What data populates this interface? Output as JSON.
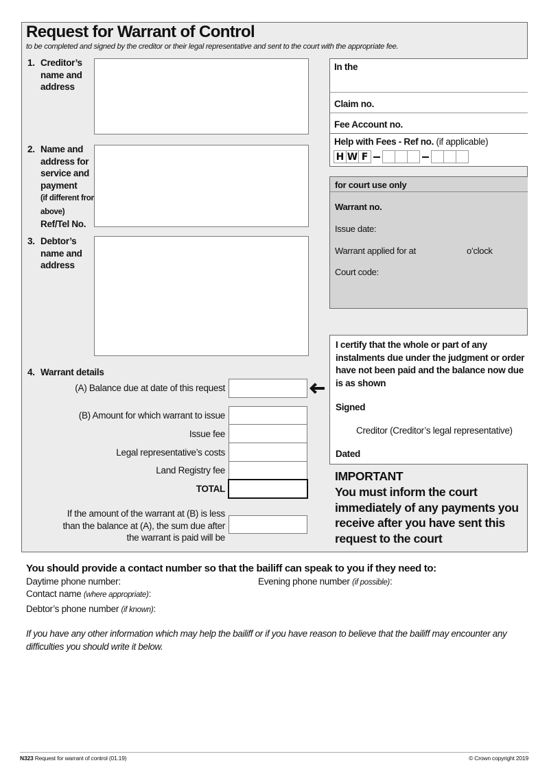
{
  "header": {
    "title": "Request for Warrant of Control",
    "subtitle": "to be completed and signed by the creditor or their legal representative and sent to the court with the appropriate fee."
  },
  "sections": {
    "creditor": {
      "number": "1.",
      "label": "Creditor’s name and address",
      "value": ""
    },
    "service": {
      "number": "2.",
      "label": "Name and address for service and payment",
      "note": "(if different from above)",
      "ref": "Ref/Tel No.",
      "value": ""
    },
    "debtor": {
      "number": "3.",
      "label": "Debtor’s name and address",
      "value": ""
    },
    "warrant": {
      "number": "4.",
      "label": "Warrant details",
      "balance_due_label": "(A) Balance due at date of this request",
      "balance_due_value": "",
      "amount_label": "(B) Amount for which warrant to issue",
      "amount_value": "",
      "issue_fee_label": "Issue fee",
      "issue_fee_value": "",
      "legal_costs_label": "Legal representative’s costs",
      "legal_costs_value": "",
      "land_registry_label": "Land Registry fee",
      "land_registry_value": "",
      "total_label": "TOTAL",
      "total_value": "",
      "remaining_label": "If the amount of the warrant at (B) is less than the balance at (A), the sum due after the warrant is paid will be",
      "remaining_value": "",
      "arrow_icon": "arrow-left-icon"
    }
  },
  "right": {
    "in_the_label": "In the",
    "in_the_value": "",
    "claim_no_label": "Claim no.",
    "claim_no_value": "",
    "fee_account_label": "Fee Account no.",
    "fee_account_value": "",
    "hwf_label": "Help with Fees - Ref no.",
    "hwf_note": "(if applicable)",
    "hwf_prefix": [
      "H",
      "W",
      "F"
    ],
    "hwf_group1": [
      "",
      "",
      ""
    ],
    "hwf_group2": [
      "",
      "",
      ""
    ]
  },
  "court_use": {
    "heading": "for court use only",
    "warrant_no": "Warrant no.",
    "issue_date": "Issue date:",
    "applied_for_at": "Warrant applied for at",
    "oclock": "o’clock",
    "court_code": "Court code:"
  },
  "certify": {
    "statement": "I certify that the whole or part of any instalments due under the judgment or order have not been paid and the balance now due is as shown",
    "signed_label": "Signed",
    "signer_role": "Creditor (Creditor’s legal representative)",
    "dated_label": "Dated"
  },
  "important": {
    "heading": "IMPORTANT",
    "text": "You must inform the court immediately of any payments you receive after you have sent this request to the court"
  },
  "contact": {
    "heading": "You should provide a contact number so that the bailiff can speak to you if they need to:",
    "daytime_label": "Daytime phone number:",
    "evening_label": "Evening phone number",
    "evening_note": "(if possible)",
    "contact_name_label": "Contact name",
    "contact_name_note": "(where appropriate)",
    "debtor_phone_label": "Debtor’s phone number",
    "debtor_phone_note": "(if known)",
    "colon": ":"
  },
  "info": {
    "text": "If you have any other information which may help the bailiff or if you have reason to believe that the bailiff may encounter any difficulties you should write it below."
  },
  "footer": {
    "form_code": "N323",
    "form_name": "Request for warrant of control (01.19)",
    "copyright": "© Crown copyright 2019"
  }
}
